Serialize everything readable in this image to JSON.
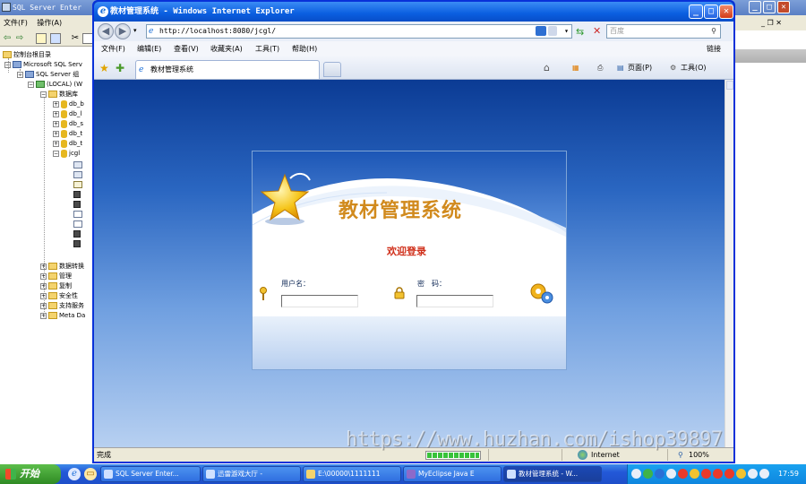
{
  "bg_window": {
    "title": "SQL Server Enter",
    "menu": [
      "文件(F)",
      "操作(A)"
    ],
    "tree": {
      "root": "控制台根目录",
      "server_group_parent": "Microsoft SQL Serv",
      "server_group": "SQL Server 组",
      "server": "(LOCAL) (W",
      "databases": "数据库",
      "db_items": [
        "db_b",
        "db_l",
        "db_s",
        "db_t",
        "db_t",
        "jcgl"
      ],
      "other_items": [
        "数据转换",
        "管理",
        "复制",
        "安全性",
        "支持服务",
        "Meta Da"
      ]
    }
  },
  "ie": {
    "title": "教材管理系统 - Windows Internet Explorer",
    "address": "http://localhost:8080/jcgl/",
    "search_placeholder": "百度",
    "menu": [
      "文件(F)",
      "编辑(E)",
      "查看(V)",
      "收藏夹(A)",
      "工具(T)",
      "帮助(H)"
    ],
    "links_label": "链接",
    "tab_label": "教材管理系统",
    "commands": {
      "page": "页面(P)",
      "tools": "工具(O)"
    },
    "status": {
      "text": "完成",
      "zone": "Internet",
      "zoom": "100%",
      "progress": 1.0
    }
  },
  "page": {
    "system_title": "教材管理系统",
    "welcome": "欢迎登录",
    "username_label": "用户名：",
    "password_label": "密　码：",
    "username_value": "",
    "password_value": ""
  },
  "watermark": "https://www.huzhan.com/ishop39897",
  "taskbar": {
    "start": "开始",
    "tasks": [
      "SQL Server Enter...",
      "迅雷游戏大厅 -",
      "E:\\00000\\1111111",
      "MyEclipse Java E",
      "教材管理系统 - W..."
    ],
    "clock": "17:59"
  },
  "colors": {
    "title_orange": "#d18a1d",
    "welcome_red": "#d0301b",
    "xp_blue": "#0a5ee0",
    "start_green": "#3fa12f"
  }
}
